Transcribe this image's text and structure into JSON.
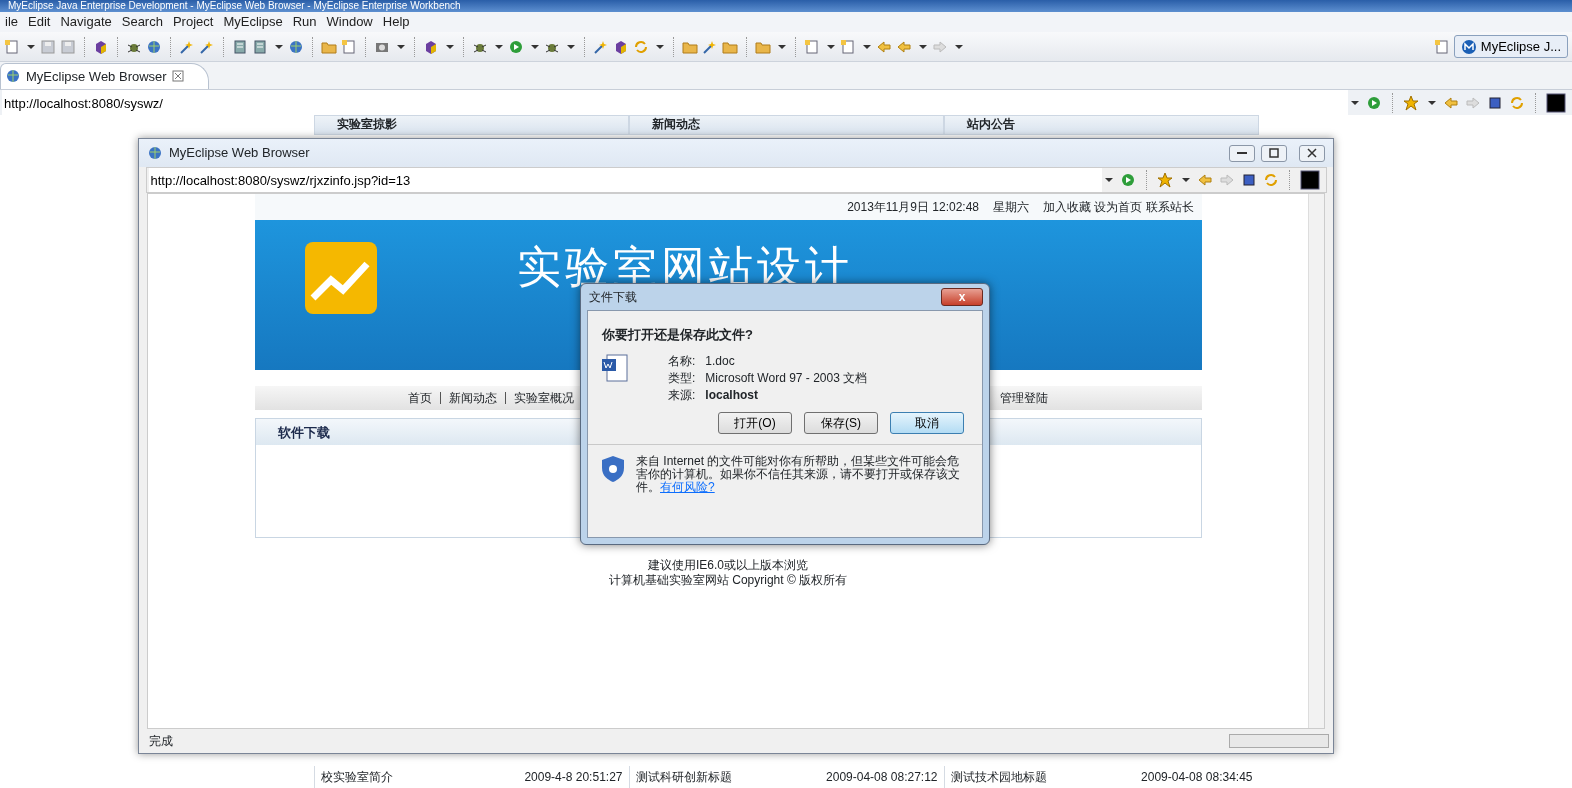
{
  "window": {
    "title": "MyEclipse Java Enterprise Development - MyEclipse Web Browser - MyEclipse Enterprise Workbench"
  },
  "menu": [
    "ile",
    "Edit",
    "Navigate",
    "Search",
    "Project",
    "MyEclipse",
    "Run",
    "Window",
    "Help"
  ],
  "perspective": {
    "label": "MyEclipse J..."
  },
  "editor_tab": {
    "label": "MyEclipse Web Browser",
    "selected": true
  },
  "address": "http://localhost:8080/syswz/",
  "background_page": {
    "section_headers": [
      "实验室掠影",
      "新闻动态",
      "站内公告"
    ],
    "rows": [
      {
        "title": "校实验室简介",
        "time": "2009-4-8 20:51:27"
      },
      {
        "title": "测试科研创新标题",
        "time": "2009-04-08 08:27:12"
      },
      {
        "title": "测试技术园地标题",
        "time": "2009-04-08 08:34:45"
      }
    ]
  },
  "popup_browser": {
    "title": "MyEclipse Web Browser",
    "address": "http://localhost:8080/syswz/rjxzinfo.jsp?id=13",
    "page": {
      "date": "2013年11月9日 12:02:48",
      "weekday": "星期六",
      "links": [
        "加入收藏",
        "设为首页",
        "联系站长"
      ],
      "banner_title": "实验室网站设计",
      "nav": [
        "首页",
        "新闻动态",
        "实验室概况",
        "管理登陆"
      ],
      "section_title": "软件下载",
      "footer": [
        "建议使用IE6.0或以上版本浏览",
        "计算机基础实验室网站 Copyright © 版权所有"
      ]
    },
    "status": "完成"
  },
  "dialog": {
    "title": "文件下载",
    "close": "x",
    "question": "你要打开还是保存此文件?",
    "fields": [
      {
        "label": "名称:",
        "value": "1.doc"
      },
      {
        "label": "类型:",
        "value": "Microsoft Word 97 - 2003 文档"
      },
      {
        "label": "来源:",
        "value": "localhost"
      }
    ],
    "buttons": [
      {
        "label": "打开(O)",
        "focused": false
      },
      {
        "label": "保存(S)",
        "focused": false
      },
      {
        "label": "取消",
        "focused": true
      }
    ],
    "warning": "来自 Internet 的文件可能对你有所帮助，但某些文件可能会危害你的计算机。如果你不信任其来源，请不要打开或保存该文件。",
    "risk_link": "有何风险?"
  }
}
